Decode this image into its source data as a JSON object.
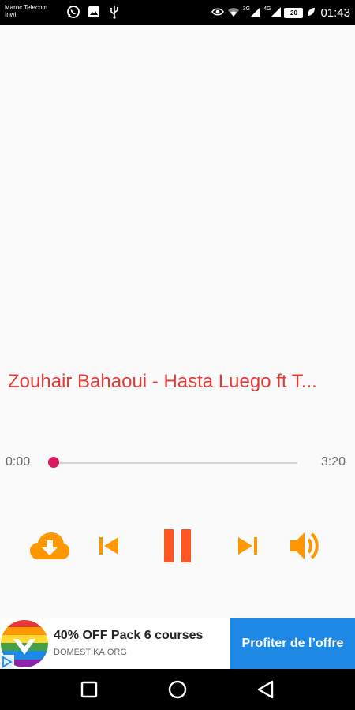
{
  "status_bar": {
    "carrier_line1": "Maroc Telecom",
    "carrier_line2": "Inwi",
    "signal1_label": "3G",
    "signal2_label": "4G",
    "battery": "20",
    "time": "01:43"
  },
  "player": {
    "track_title": "Zouhair Bahaoui - Hasta Luego ft T...",
    "elapsed": "0:00",
    "duration": "3:20",
    "progress_fraction": 0.0,
    "accent_color": "#ff9800",
    "pause_color": "#ff5722",
    "title_color": "#e53935",
    "thumb_color": "#d81b60"
  },
  "ad": {
    "title": "40% OFF Pack 6 courses",
    "domain": "DOMESTIKA.ORG",
    "cta": "Profiter de l’offre",
    "cta_color": "#1e88e5"
  }
}
